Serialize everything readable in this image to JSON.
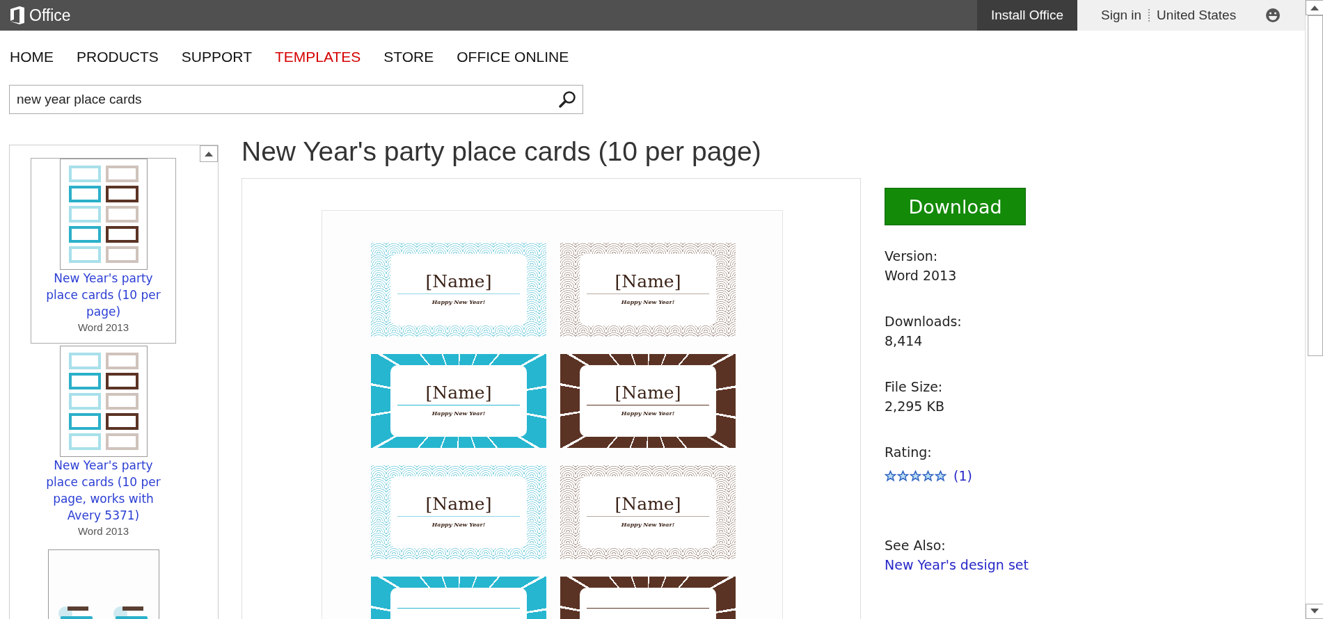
{
  "top_bar": {
    "brand": "Office",
    "install": "Install Office",
    "sign_in": "Sign in",
    "region": "United States"
  },
  "nav": [
    {
      "label": "HOME",
      "selected": false
    },
    {
      "label": "PRODUCTS",
      "selected": false
    },
    {
      "label": "SUPPORT",
      "selected": false
    },
    {
      "label": "TEMPLATES",
      "selected": true
    },
    {
      "label": "STORE",
      "selected": false
    },
    {
      "label": "OFFICE ONLINE",
      "selected": false
    }
  ],
  "search": {
    "value": "new year place cards"
  },
  "sidebar": {
    "items": [
      {
        "kind": "cards",
        "title": "New Year's party place cards (10 per page)",
        "subtitle": "Word 2013",
        "selected": true
      },
      {
        "kind": "cards",
        "title": "New Year's party place cards (10 per page, works with Avery 5371)",
        "subtitle": "Word 2013",
        "selected": false
      },
      {
        "kind": "tents",
        "selected": false
      }
    ]
  },
  "template": {
    "title": "New Year's party place cards (10 per page)",
    "cards": [
      {
        "kind": "pattern",
        "color": "#8fd6e3",
        "name": "[Name]",
        "greeting": "Happy New Year!"
      },
      {
        "kind": "pattern",
        "color": "#b8a9a0",
        "name": "[Name]",
        "greeting": "Happy New Year!"
      },
      {
        "kind": "burst",
        "color": "#27b6d0",
        "name": "[Name]",
        "greeting": "Happy New Year!"
      },
      {
        "kind": "burst",
        "color": "#5b3324",
        "name": "[Name]",
        "greeting": "Happy New Year!"
      },
      {
        "kind": "pattern",
        "color": "#8fd6e3",
        "name": "[Name]",
        "greeting": "Happy New Year!"
      },
      {
        "kind": "pattern",
        "color": "#b8a9a0",
        "name": "[Name]",
        "greeting": "Happy New Year!"
      },
      {
        "kind": "burst",
        "color": "#27b6d0"
      },
      {
        "kind": "burst",
        "color": "#5b3324"
      }
    ]
  },
  "details": {
    "download": "Download",
    "fields": [
      {
        "label": "Version:",
        "value": "Word 2013"
      },
      {
        "label": "Downloads:",
        "value": "8,414"
      },
      {
        "label": "File Size:",
        "value": "2,295 KB"
      }
    ],
    "rating": {
      "label": "Rating:",
      "stars": 5,
      "count": "(1)"
    },
    "see_also": {
      "label": "See Also:",
      "link": "New Year's design set"
    }
  }
}
